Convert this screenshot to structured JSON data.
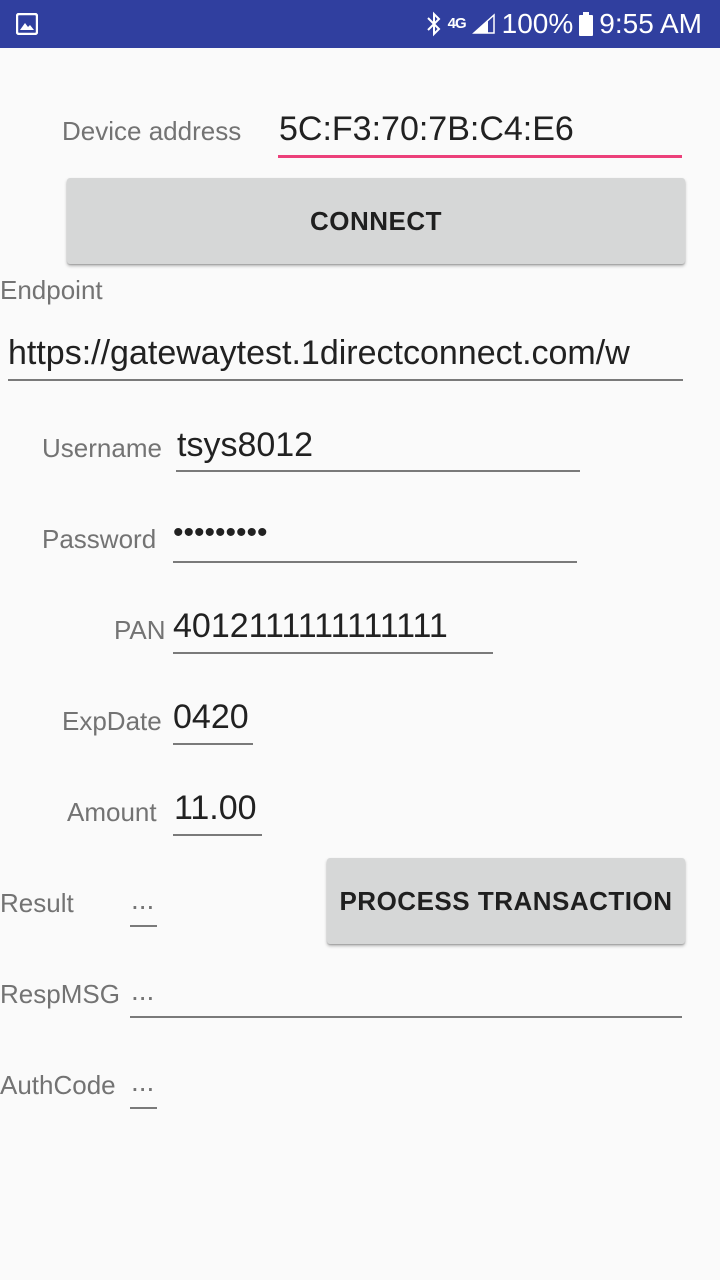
{
  "status_bar": {
    "network": "4G",
    "battery": "100%",
    "time": "9:55 AM"
  },
  "device": {
    "label": "Device address",
    "value": "5C:F3:70:7B:C4:E6"
  },
  "connect_button": "CONNECT",
  "endpoint": {
    "label": "Endpoint",
    "value": "https://gatewaytest.1directconnect.com/w"
  },
  "username": {
    "label": "Username",
    "value": "tsys8012"
  },
  "password": {
    "label": "Password",
    "value": "•••••••••"
  },
  "pan": {
    "label": "PAN",
    "value": "4012111111111111"
  },
  "expdate": {
    "label": "ExpDate",
    "value": "0420"
  },
  "amount": {
    "label": "Amount",
    "value": "11.00"
  },
  "result": {
    "label": "Result",
    "value": "..."
  },
  "process_button": "PROCESS TRANSACTION",
  "respmsg": {
    "label": "RespMSG",
    "value": "..."
  },
  "authcode": {
    "label": "AuthCode",
    "value": "..."
  },
  "colors": {
    "status_bar": "#303f9f",
    "accent_underline": "#ec407a",
    "button_bg": "#d6d7d7"
  }
}
